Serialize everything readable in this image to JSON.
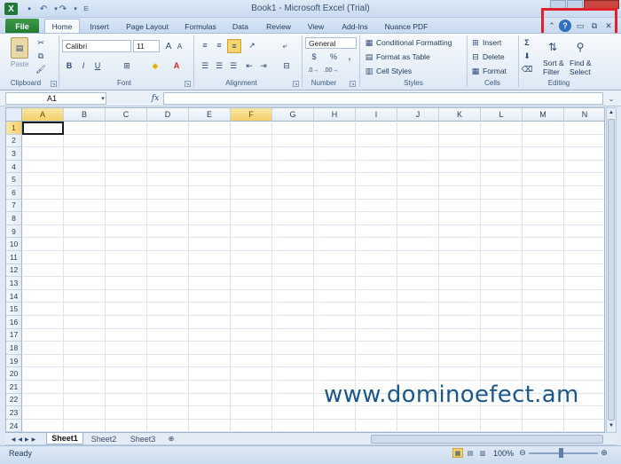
{
  "window": {
    "title": "Book1 - Microsoft Excel (Trial)",
    "app_logo": "X"
  },
  "tabs": {
    "file": "File",
    "items": [
      "Home",
      "Insert",
      "Page Layout",
      "Formulas",
      "Data",
      "Review",
      "View",
      "Add-Ins",
      "Nuance PDF"
    ]
  },
  "ribbon": {
    "clipboard": {
      "label": "Clipboard",
      "paste": "Paste"
    },
    "font": {
      "label": "Font",
      "name": "Calibri",
      "size": "11",
      "bold": "B",
      "italic": "I",
      "underline": "U"
    },
    "alignment": {
      "label": "Alignment"
    },
    "number": {
      "label": "Number",
      "format": "General",
      "percent": "%",
      "comma": ","
    },
    "styles": {
      "label": "Styles",
      "conditional": "Conditional Formatting",
      "format_table": "Format as Table",
      "cell_styles": "Cell Styles"
    },
    "cells": {
      "label": "Cells",
      "insert": "Insert",
      "delete": "Delete",
      "format": "Format"
    },
    "editing": {
      "label": "Editing",
      "sigma": "Σ",
      "sort_top": "Sort &",
      "sort_bottom": "Filter",
      "find_top": "Find &",
      "find_bottom": "Select"
    }
  },
  "formula_bar": {
    "name_box": "A1",
    "fx": "fx",
    "value": ""
  },
  "columns": [
    "A",
    "B",
    "C",
    "D",
    "E",
    "F",
    "G",
    "H",
    "I",
    "J",
    "K",
    "L",
    "M",
    "N"
  ],
  "rows": [
    "1",
    "2",
    "3",
    "4",
    "5",
    "6",
    "7",
    "8",
    "9",
    "10",
    "11",
    "12",
    "13",
    "14",
    "15",
    "16",
    "17",
    "18",
    "19",
    "20",
    "21",
    "22",
    "23",
    "24"
  ],
  "sheets": [
    "Sheet1",
    "Sheet2",
    "Sheet3"
  ],
  "status": {
    "ready": "Ready",
    "zoom": "100%"
  },
  "watermark": "www.dominoefect.am",
  "colors": {
    "highlight": "#e0202a",
    "file_tab": "#1f7a30",
    "watermark": "#1d5789"
  }
}
